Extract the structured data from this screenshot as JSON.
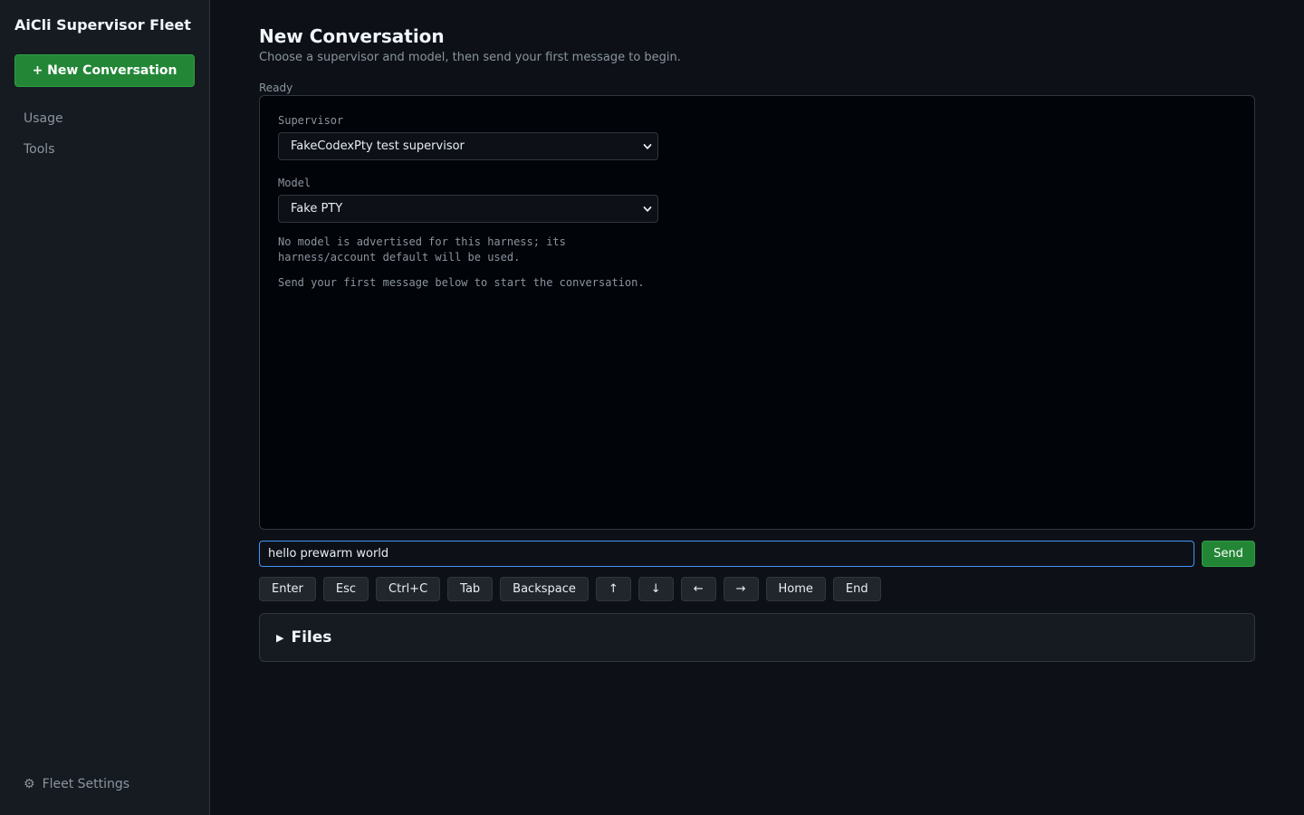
{
  "sidebar": {
    "brand": "AiCli Supervisor Fleet",
    "new_conversation_label": "+ New Conversation",
    "nav": [
      {
        "label": "Usage"
      },
      {
        "label": "Tools"
      }
    ],
    "settings_icon": "gear-icon",
    "settings_label": "Fleet Settings"
  },
  "main": {
    "title": "New Conversation",
    "subtitle": "Choose a supervisor and model, then send your first message to begin.",
    "status": "Ready",
    "terminal": {
      "supervisor_label": "Supervisor",
      "supervisor_value": "FakeCodexPty test supervisor",
      "model_label": "Model",
      "model_value": "Fake PTY",
      "note_model": "No model is advertised for this harness; its harness/account default will be used.",
      "note_send": "Send your first message below to start the conversation."
    },
    "input": {
      "value": "hello prewarm world",
      "send_label": "Send"
    },
    "keys": [
      "Enter",
      "Esc",
      "Ctrl+C",
      "Tab",
      "Backspace",
      "↑",
      "↓",
      "←",
      "→",
      "Home",
      "End"
    ],
    "files": {
      "toggle_icon": "triangle-right-icon",
      "label": "Files"
    }
  },
  "colors": {
    "accent_green": "#238636",
    "focus_blue": "#4493f8",
    "background": "#0d1117"
  }
}
